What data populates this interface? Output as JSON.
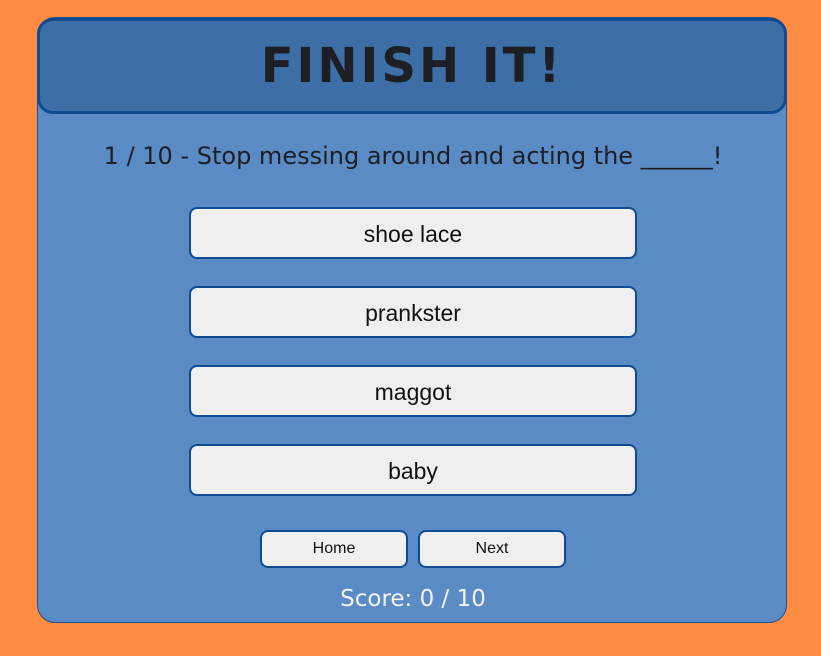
{
  "app": {
    "title": "FINISH IT!"
  },
  "question": {
    "text": "1 / 10 - Stop messing around and acting the ______!"
  },
  "answers": [
    {
      "label": "shoe lace"
    },
    {
      "label": "prankster"
    },
    {
      "label": "maggot"
    },
    {
      "label": "baby"
    }
  ],
  "nav": {
    "home_label": "Home",
    "next_label": "Next"
  },
  "score": {
    "text": "Score: 0 / 10"
  },
  "colors": {
    "background": "#ff8c42",
    "card": "#5a8bc4",
    "header": "#3d6ea5",
    "border": "#0f4b91",
    "button": "#efefef"
  }
}
